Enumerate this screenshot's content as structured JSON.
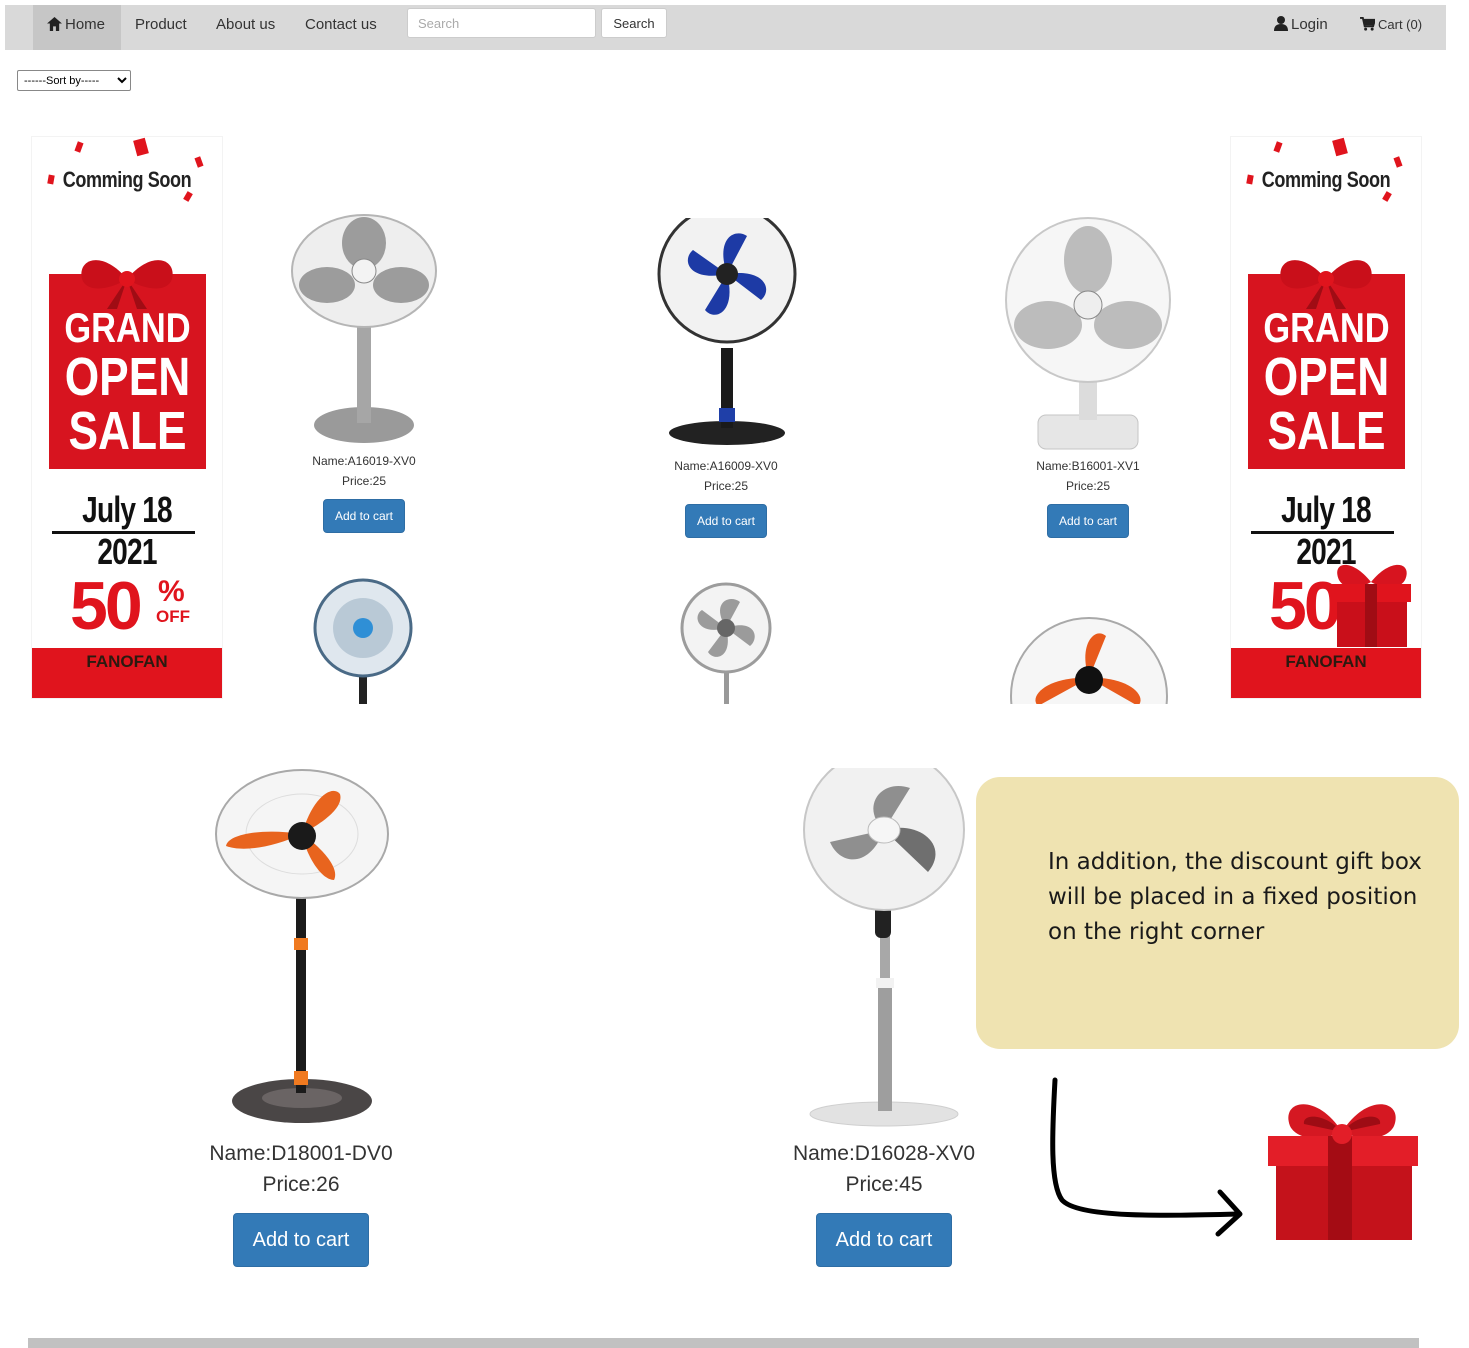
{
  "nav": {
    "home": "Home",
    "product": "Product",
    "about": "About us",
    "contact": "Contact us",
    "search_placeholder": "Search",
    "search_button": "Search",
    "login": "Login",
    "cart": "Cart (0)"
  },
  "sort": {
    "selected": "------Sort by-----"
  },
  "banner": {
    "coming_soon": "Comming Soon",
    "sale_line1": "GRAND",
    "sale_line2": "OPEN",
    "sale_line3": "SALE",
    "date": "July 18 2021",
    "discount": "50",
    "percent": "%",
    "off": "OFF",
    "brand": "FANOFAN",
    "accent_color": "#e0141d"
  },
  "products_top": [
    {
      "name": "Name:A16019-XV0",
      "price": "Price:25",
      "button": "Add to cart"
    },
    {
      "name": "Name:A16009-XV0",
      "price": "Price:25",
      "button": "Add to cart"
    },
    {
      "name": "Name:B16001-XV1",
      "price": "Price:25",
      "button": "Add to cart"
    }
  ],
  "products_bottom": [
    {
      "name": "Name:D18001-DV0",
      "price": "Price:26",
      "button": "Add to cart"
    },
    {
      "name": "Name:D16028-XV0",
      "price": "Price:45",
      "button": "Add to cart"
    }
  ],
  "annotation": {
    "text": "In addition, the discount gift box will be placed in a fixed position on the right corner",
    "background": "#efe3b1"
  },
  "colors": {
    "navbar": "#d9d9d9",
    "button": "#337ab7",
    "sale_red": "#d7141f"
  }
}
